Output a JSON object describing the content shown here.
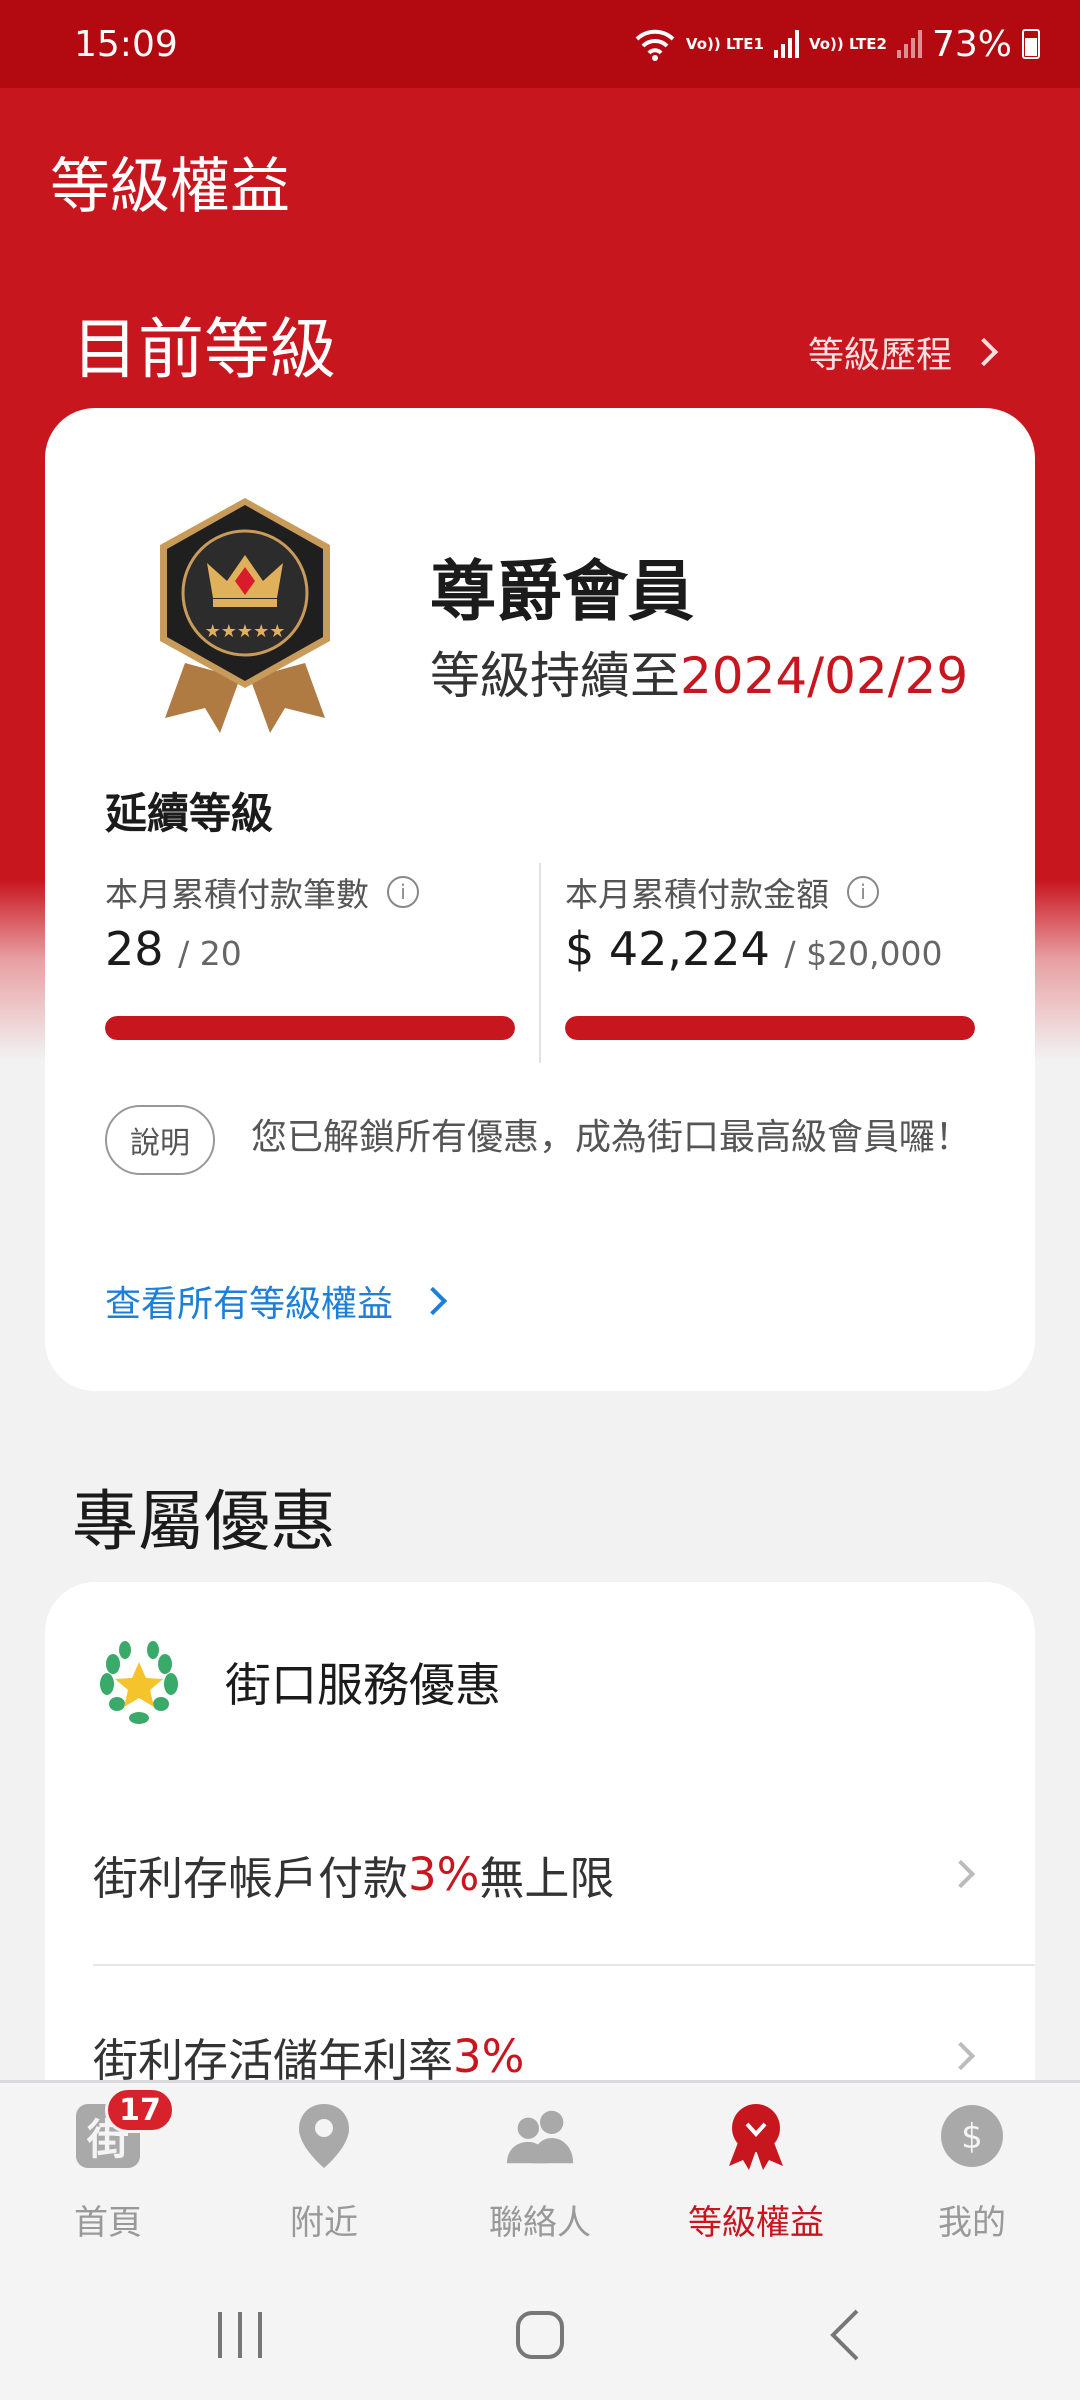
{
  "status_bar": {
    "time": "15:09",
    "sim1_label": "Vo)) LTE1",
    "sim2_label": "Vo)) LTE2",
    "battery": "73%"
  },
  "header": {
    "title": "等級權益"
  },
  "current_level": {
    "section_title": "目前等級",
    "history_link": "等級歷程",
    "member_name": "尊爵會員",
    "valid_prefix": "等級持續至",
    "valid_date": "2024/02/29",
    "extend_title": "延續等級",
    "count_stat": {
      "label": "本月累積付款筆數",
      "value": "28",
      "goal": "/ 20",
      "progress": 1.0
    },
    "amount_stat": {
      "label": "本月累積付款金額",
      "value": "$ 42,224",
      "goal": "/ $20,000",
      "progress": 1.0
    },
    "explain_pill": "說明",
    "explain_text": "您已解鎖所有優惠，成為街口最高級會員囉！",
    "all_benefits_link": "查看所有等級權益"
  },
  "exclusive_offers": {
    "section_title": "專屬優惠",
    "group_title": "街口服務優惠",
    "rows": [
      {
        "text": "街利存帳戶付款",
        "highlight": "3%",
        "suffix": "無上限"
      },
      {
        "text": "街利存活儲年利率",
        "highlight": "3%",
        "suffix": ""
      }
    ]
  },
  "tabbar": {
    "notification_count": "17",
    "tabs": [
      "首頁",
      "附近",
      "聯絡人",
      "等級權益",
      "我的"
    ],
    "active_index": 3,
    "home_icon_char": "街"
  },
  "colors": {
    "brand_red": "#c8161f",
    "status_red": "#b30a12",
    "link_blue": "#1e7fd8"
  }
}
